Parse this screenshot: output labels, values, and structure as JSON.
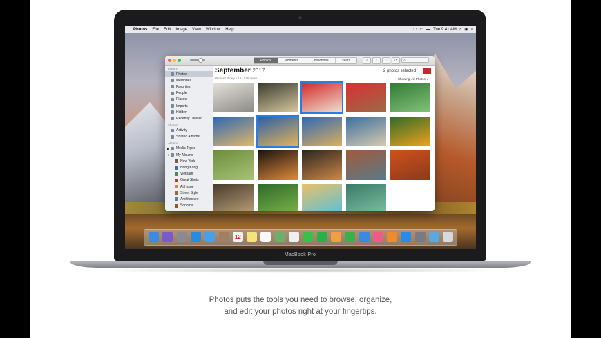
{
  "menubar": {
    "app": "Photos",
    "items": [
      "File",
      "Edit",
      "Image",
      "View",
      "Window",
      "Help"
    ],
    "clock": "Tue 9:41 AM"
  },
  "toolbar": {
    "tabs": [
      "Photos",
      "Moments",
      "Collections",
      "Years"
    ],
    "active_tab": "Photos"
  },
  "sidebar": {
    "library_header": "Library",
    "library_items": [
      {
        "label": "Photos",
        "selected": true
      },
      {
        "label": "Memories"
      },
      {
        "label": "Favorites"
      },
      {
        "label": "People"
      },
      {
        "label": "Places"
      },
      {
        "label": "Imports"
      },
      {
        "label": "Hidden"
      },
      {
        "label": "Recently Deleted"
      }
    ],
    "shared_header": "Shared",
    "shared_items": [
      {
        "label": "Activity"
      },
      {
        "label": "Shared Albums"
      }
    ],
    "albums_header": "Albums",
    "album_items": [
      {
        "label": "Media Types"
      },
      {
        "label": "My Albums"
      }
    ],
    "my_albums": [
      {
        "label": "New York",
        "color": "#7a5a3a"
      },
      {
        "label": "Hong Kong",
        "color": "#3b6fa8"
      },
      {
        "label": "Vietnam",
        "color": "#4f8a4a"
      },
      {
        "label": "Great Shots",
        "color": "#c0392b"
      },
      {
        "label": "At Home",
        "color": "#d98b2b"
      },
      {
        "label": "Street Style",
        "color": "#8b6a4a"
      },
      {
        "label": "Architecture",
        "color": "#6a7a8a"
      },
      {
        "label": "Sonoma",
        "color": "#a0522d"
      }
    ]
  },
  "main": {
    "month": "September",
    "year": "2017",
    "subtitle": "Photos Library • 144,875 items",
    "selected_count": "2 photos selected",
    "showing": "Showing: All Photos"
  },
  "photos": [
    {
      "name": "wall-portrait",
      "c1": "#e4e1da",
      "c2": "#8c8a84",
      "selected": false
    },
    {
      "name": "man-portrait",
      "c1": "#3a3a2e",
      "c2": "#d7c9a0",
      "selected": false
    },
    {
      "name": "hair-flip",
      "c1": "#d22a2a",
      "c2": "#f0e0d0",
      "selected": true
    },
    {
      "name": "friends-red-wall",
      "c1": "#d93030",
      "c2": "#9c6a4a",
      "selected": false
    },
    {
      "name": "green-leaves",
      "c1": "#2f7a35",
      "c2": "#86c27a",
      "selected": false
    },
    {
      "name": "rock-arch-1",
      "c1": "#2e66b3",
      "c2": "#e0b86a",
      "selected": false
    },
    {
      "name": "rock-arch-2",
      "c1": "#2a5fa8",
      "c2": "#e2b35a",
      "selected": true
    },
    {
      "name": "rock-arch-3",
      "c1": "#2f68b6",
      "c2": "#dcae5c",
      "selected": false
    },
    {
      "name": "boat-coast",
      "c1": "#3a6fa0",
      "c2": "#d8cab0",
      "selected": false
    },
    {
      "name": "hibiscus",
      "c1": "#2f6a2a",
      "c2": "#f0a21e",
      "selected": false
    },
    {
      "name": "palm-frond",
      "c1": "#6c8e3a",
      "c2": "#a9c27a",
      "selected": false
    },
    {
      "name": "sunset-silhouette",
      "c1": "#1a1410",
      "c2": "#e08a3a",
      "selected": false
    },
    {
      "name": "sea-dusk",
      "c1": "#2a2622",
      "c2": "#cf8846",
      "selected": false
    },
    {
      "name": "sky-sunset",
      "c1": "#a05a3a",
      "c2": "#5a7a8a",
      "selected": false
    },
    {
      "name": "orange-dancer",
      "c1": "#d0501e",
      "c2": "#8a3a1a",
      "selected": false
    },
    {
      "name": "stone-arch",
      "c1": "#4a3a2a",
      "c2": "#b8a07a",
      "selected": false
    },
    {
      "name": "bamboo",
      "c1": "#2f6a2a",
      "c2": "#7ab24a",
      "selected": false
    },
    {
      "name": "blonde-portrait",
      "c1": "#e8c06a",
      "c2": "#5ac0d8",
      "selected": false
    },
    {
      "name": "green-water",
      "c1": "#3a7a6a",
      "c2": "#7ac0a0",
      "selected": false
    }
  ],
  "dock": [
    {
      "name": "finder-icon",
      "color": "#3b8be0",
      "glyph": ""
    },
    {
      "name": "siri-icon",
      "color": "#7a5ac8",
      "glyph": ""
    },
    {
      "name": "launchpad-icon",
      "color": "#8a8a92",
      "glyph": ""
    },
    {
      "name": "safari-icon",
      "color": "#2a8ae0",
      "glyph": ""
    },
    {
      "name": "mail-icon",
      "color": "#4aa0e8",
      "glyph": ""
    },
    {
      "name": "contacts-icon",
      "color": "#a08060",
      "glyph": ""
    },
    {
      "name": "calendar-icon",
      "color": "#f2f2f2",
      "glyph": "12"
    },
    {
      "name": "notes-icon",
      "color": "#f6e27a",
      "glyph": ""
    },
    {
      "name": "reminders-icon",
      "color": "#f8f8f8",
      "glyph": ""
    },
    {
      "name": "maps-icon",
      "color": "#6ab06a",
      "glyph": ""
    },
    {
      "name": "photos-icon",
      "color": "#f0f0f0",
      "glyph": ""
    },
    {
      "name": "messages-icon",
      "color": "#3ac04a",
      "glyph": ""
    },
    {
      "name": "facetime-icon",
      "color": "#2ab04a",
      "glyph": ""
    },
    {
      "name": "pages-icon",
      "color": "#f0a040",
      "glyph": ""
    },
    {
      "name": "numbers-icon",
      "color": "#3ab04a",
      "glyph": ""
    },
    {
      "name": "keynote-icon",
      "color": "#3a8ae0",
      "glyph": ""
    },
    {
      "name": "itunes-icon",
      "color": "#f05a8a",
      "glyph": ""
    },
    {
      "name": "ibooks-icon",
      "color": "#f08a2a",
      "glyph": ""
    },
    {
      "name": "app-store-icon",
      "color": "#2a8ae8",
      "glyph": ""
    },
    {
      "name": "system-preferences-icon",
      "color": "#7a7a82",
      "glyph": ""
    },
    {
      "name": "downloads-folder-icon",
      "color": "#5aa8e0",
      "glyph": ""
    },
    {
      "name": "trash-icon",
      "color": "#d8d8dc",
      "glyph": ""
    }
  ],
  "device_label": "MacBook Pro",
  "caption": {
    "line1": "Photos puts the tools you need to browse, organize,",
    "line2": "and edit your photos right at your fingertips."
  }
}
